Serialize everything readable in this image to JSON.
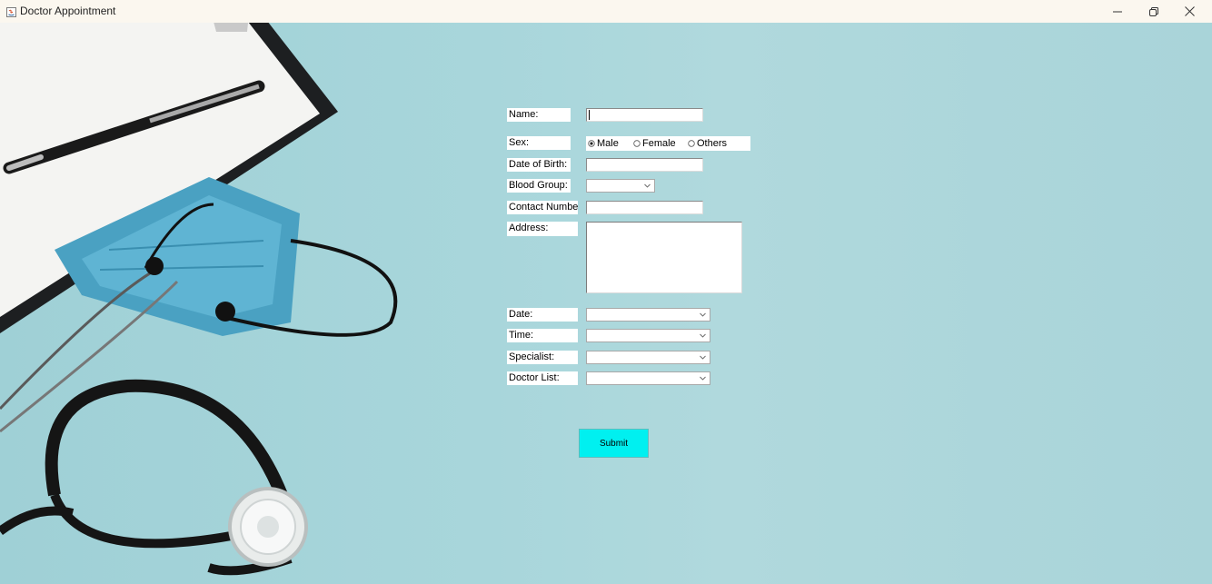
{
  "window": {
    "title": "Doctor Appointment",
    "buttons": {
      "minimize": "minimize-icon",
      "maximize": "restore-icon",
      "close": "close-icon"
    }
  },
  "form": {
    "name_label": "Name:",
    "name_value": "",
    "sex_label": "Sex:",
    "sex_options": [
      "Male",
      "Female",
      "Others"
    ],
    "sex_selected": "Male",
    "dob_label": "Date of Birth:",
    "dob_value": "",
    "blood_group_label": "Blood Group:",
    "blood_group_value": "",
    "contact_label": "Contact Number:",
    "contact_value": "",
    "address_label": "Address:",
    "address_value": "",
    "date_label": "Date:",
    "date_value": "",
    "time_label": "Time:",
    "time_value": "",
    "specialist_label": "Specialist:",
    "specialist_value": "",
    "doctor_label": "Doctor List:",
    "doctor_value": "",
    "submit_label": "Submit"
  },
  "colors": {
    "background": "#aad7dc",
    "submit_button": "#00f0f0",
    "title_bar": "#fbf7ef"
  }
}
